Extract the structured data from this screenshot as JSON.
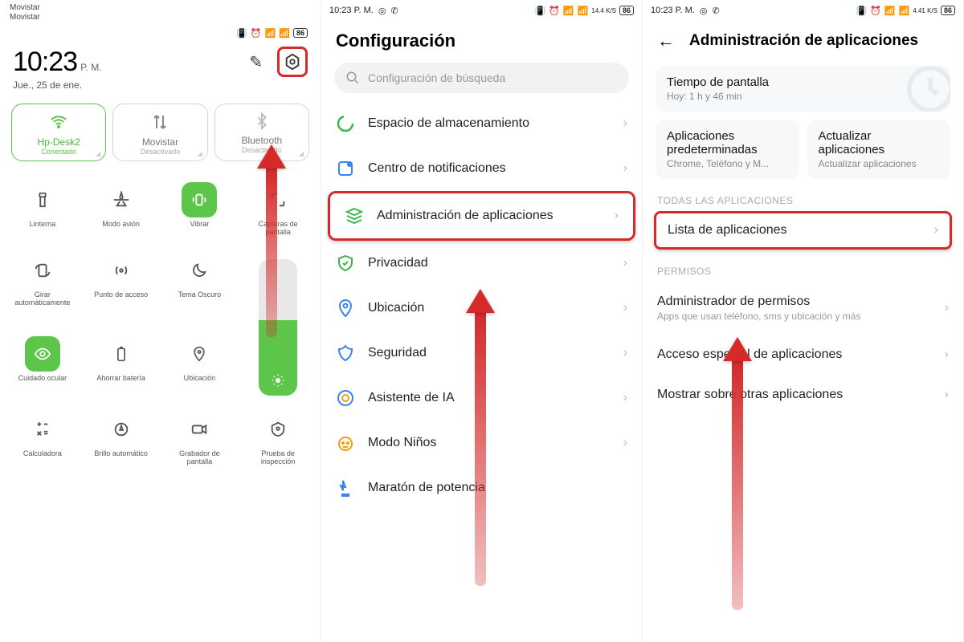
{
  "screen1": {
    "carrier": "Movistar",
    "time": "10:23",
    "ampm": "P. M.",
    "date": "Jue., 25 de ene.",
    "battery": "86",
    "tiles": [
      {
        "label": "Hp-Desk2",
        "sub": "Conectado"
      },
      {
        "label": "Movistar",
        "sub": "Desactivado"
      },
      {
        "label": "Bluetooth",
        "sub": "Desactivado"
      }
    ],
    "grid": [
      "Linterna",
      "Modo avión",
      "Vibrar",
      "Capturas de pantalla",
      "Girar automáticamente",
      "Punto de acceso",
      "Tema Oscuro",
      "",
      "Cuidado ocular",
      "Ahorrar batería",
      "Ubicación",
      "",
      "Calculadora",
      "Brillo automático",
      "Grabador de pantalla",
      "Prueba de inspección"
    ]
  },
  "screen2": {
    "time": "10:23 P. M.",
    "battery": "86",
    "net": "14.4 K/S",
    "title": "Configuración",
    "search_placeholder": "Configuración de búsqueda",
    "items": [
      "Espacio de almacenamiento",
      "Centro de notificaciones",
      "Administración de aplicaciones",
      "Privacidad",
      "Ubicación",
      "Seguridad",
      "Asistente de IA",
      "Modo Niños",
      "Maratón de potencia"
    ]
  },
  "screen3": {
    "time": "10:23 P. M.",
    "battery": "86",
    "net": "4.41 K/S",
    "title": "Administración de aplicaciones",
    "screentime": {
      "title": "Tiempo de pantalla",
      "sub": "Hoy: 1 h y 46 min"
    },
    "defaults": {
      "title": "Aplicaciones predeterminadas",
      "sub": "Chrome, Teléfono y M..."
    },
    "update": {
      "title": "Actualizar aplicaciones",
      "sub": "Actualizar aplicaciones"
    },
    "section_all": "TODAS LAS APLICACIONES",
    "applist": "Lista de aplicaciones",
    "section_perm": "PERMISOS",
    "permmgr": {
      "title": "Administrador de permisos",
      "sub": "Apps que usan teléfono, sms y ubicación y más"
    },
    "special": "Acceso especial de aplicaciones",
    "overlay": "Mostrar sobre otras aplicaciones"
  }
}
